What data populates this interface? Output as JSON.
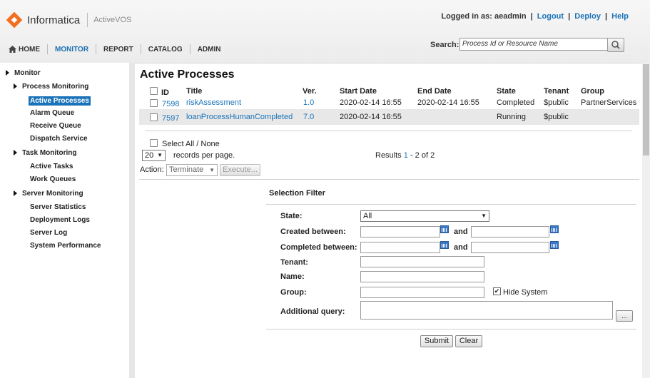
{
  "header": {
    "brand": "Informatica",
    "product": "ActiveVOS",
    "logged_in_label": "Logged in as: aeadmin",
    "logout": "Logout",
    "deploy": "Deploy",
    "help": "Help",
    "separator": "|"
  },
  "nav": {
    "home": "HOME",
    "monitor": "MONITOR",
    "report": "REPORT",
    "catalog": "CATALOG",
    "admin": "ADMIN"
  },
  "search": {
    "label": "Search:",
    "placeholder": "Process Id or Resource Name"
  },
  "sidebar": {
    "monitor": "Monitor",
    "process_monitoring": "Process Monitoring",
    "active_processes": "Active Processes",
    "alarm_queue": "Alarm Queue",
    "receive_queue": "Receive Queue",
    "dispatch_service": "Dispatch Service",
    "task_monitoring": "Task Monitoring",
    "active_tasks": "Active Tasks",
    "work_queues": "Work Queues",
    "server_monitoring": "Server Monitoring",
    "server_statistics": "Server Statistics",
    "deployment_logs": "Deployment Logs",
    "server_log": "Server Log",
    "system_performance": "System Performance"
  },
  "main": {
    "title": "Active Processes",
    "columns": {
      "id": "ID",
      "title": "Title",
      "ver": "Ver.",
      "start_date": "Start Date",
      "end_date": "End Date",
      "state": "State",
      "tenant": "Tenant",
      "group": "Group"
    },
    "rows": [
      {
        "id": "7598",
        "title": "riskAssessment",
        "ver": "1.0",
        "start": "2020-02-14 16:55",
        "end": "2020-02-14 16:55",
        "state": "Completed",
        "tenant": "$public",
        "group": "PartnerServices"
      },
      {
        "id": "7597",
        "title": "loanProcessHumanCompleted",
        "ver": "7.0",
        "start": "2020-02-14 16:55",
        "end": "",
        "state": "Running",
        "tenant": "$public",
        "group": ""
      }
    ],
    "select_all": "Select All / None",
    "page_size": "20",
    "records_per_page": "records per page.",
    "results_prefix": "Results",
    "results_from": "1",
    "results_dash": "- 2",
    "results_of": "of",
    "results_total": "2",
    "action_label": "Action:",
    "action_value": "Terminate",
    "execute": "Execute..."
  },
  "filter": {
    "heading": "Selection Filter",
    "state_label": "State:",
    "state_value": "All",
    "created_label": "Created between:",
    "completed_label": "Completed between:",
    "and": "and",
    "tenant_label": "Tenant:",
    "name_label": "Name:",
    "group_label": "Group:",
    "hide_system": "Hide System",
    "hide_system_checked": "✔",
    "additional_label": "Additional query:",
    "ellipsis": "...",
    "submit": "Submit",
    "clear": "Clear"
  }
}
